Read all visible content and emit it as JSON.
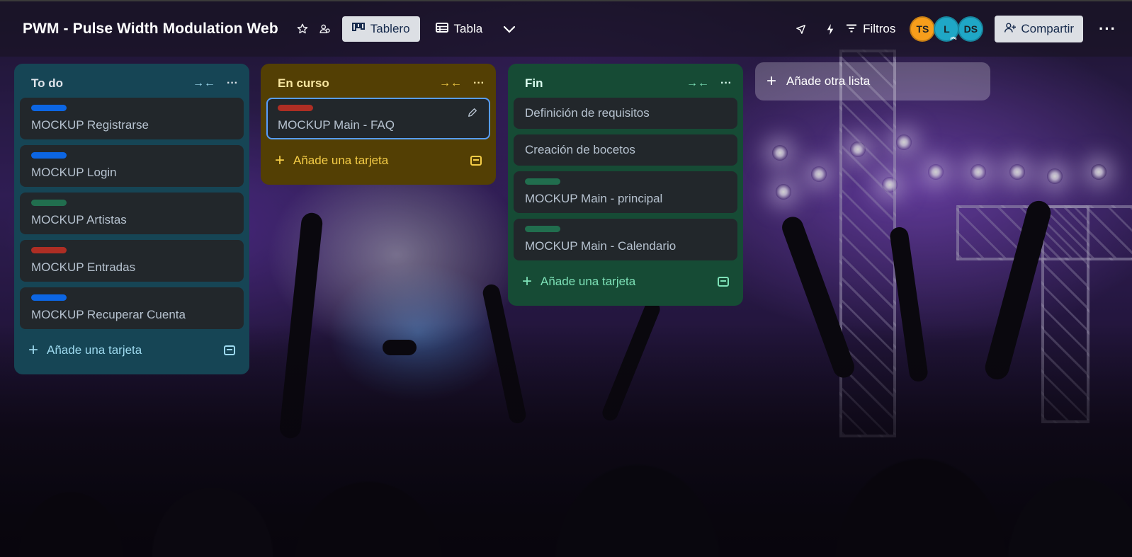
{
  "header": {
    "board_title": "PWM - Pulse Width Modulation Web",
    "views": [
      {
        "label": "Tablero",
        "icon": "board-icon",
        "active": true
      },
      {
        "label": "Tabla",
        "icon": "table-icon",
        "active": false
      }
    ],
    "filters_label": "Filtros",
    "avatars": [
      {
        "initials": "TS",
        "color": "#f79e1b"
      },
      {
        "initials": "L",
        "color": "#1fa7c6"
      },
      {
        "initials": "DS",
        "color": "#1fa7c6"
      }
    ],
    "share_label": "Compartir"
  },
  "lists": [
    {
      "title": "To do",
      "color": "#164555",
      "title_color": "#dee4ea",
      "cards": [
        {
          "label_color": "#0c66e4",
          "text": "MOCKUP Registrarse"
        },
        {
          "label_color": "#0c66e4",
          "text": "MOCKUP Login"
        },
        {
          "label_color": "#216e4e",
          "text": "MOCKUP Artistas"
        },
        {
          "label_color": "#ae2e24",
          "text": "MOCKUP Entradas"
        },
        {
          "label_color": "#0c66e4",
          "text": "MOCKUP Recuperar Cuenta"
        }
      ],
      "add_card_label": "Añade una tarjeta",
      "accent": "#9dd9ee"
    },
    {
      "title": "En curso",
      "color": "#533f04",
      "title_color": "#f8e6a0",
      "cards": [
        {
          "label_color": "#ae2e24",
          "text": "MOCKUP Main - FAQ",
          "selected": true
        }
      ],
      "add_card_label": "Añade una tarjeta",
      "accent": "#f5cd47"
    },
    {
      "title": "Fin",
      "color": "#164b35",
      "title_color": "#dcfff1",
      "cards": [
        {
          "label_color": null,
          "text": "Definición de requisitos"
        },
        {
          "label_color": null,
          "text": "Creación de bocetos"
        },
        {
          "label_color": "#216e4e",
          "text": "MOCKUP Main - principal"
        },
        {
          "label_color": "#216e4e",
          "text": "MOCKUP Main - Calendario"
        }
      ],
      "add_card_label": "Añade una tarjeta",
      "accent": "#7ee2b8"
    }
  ],
  "add_list_label": "Añade otra lista"
}
